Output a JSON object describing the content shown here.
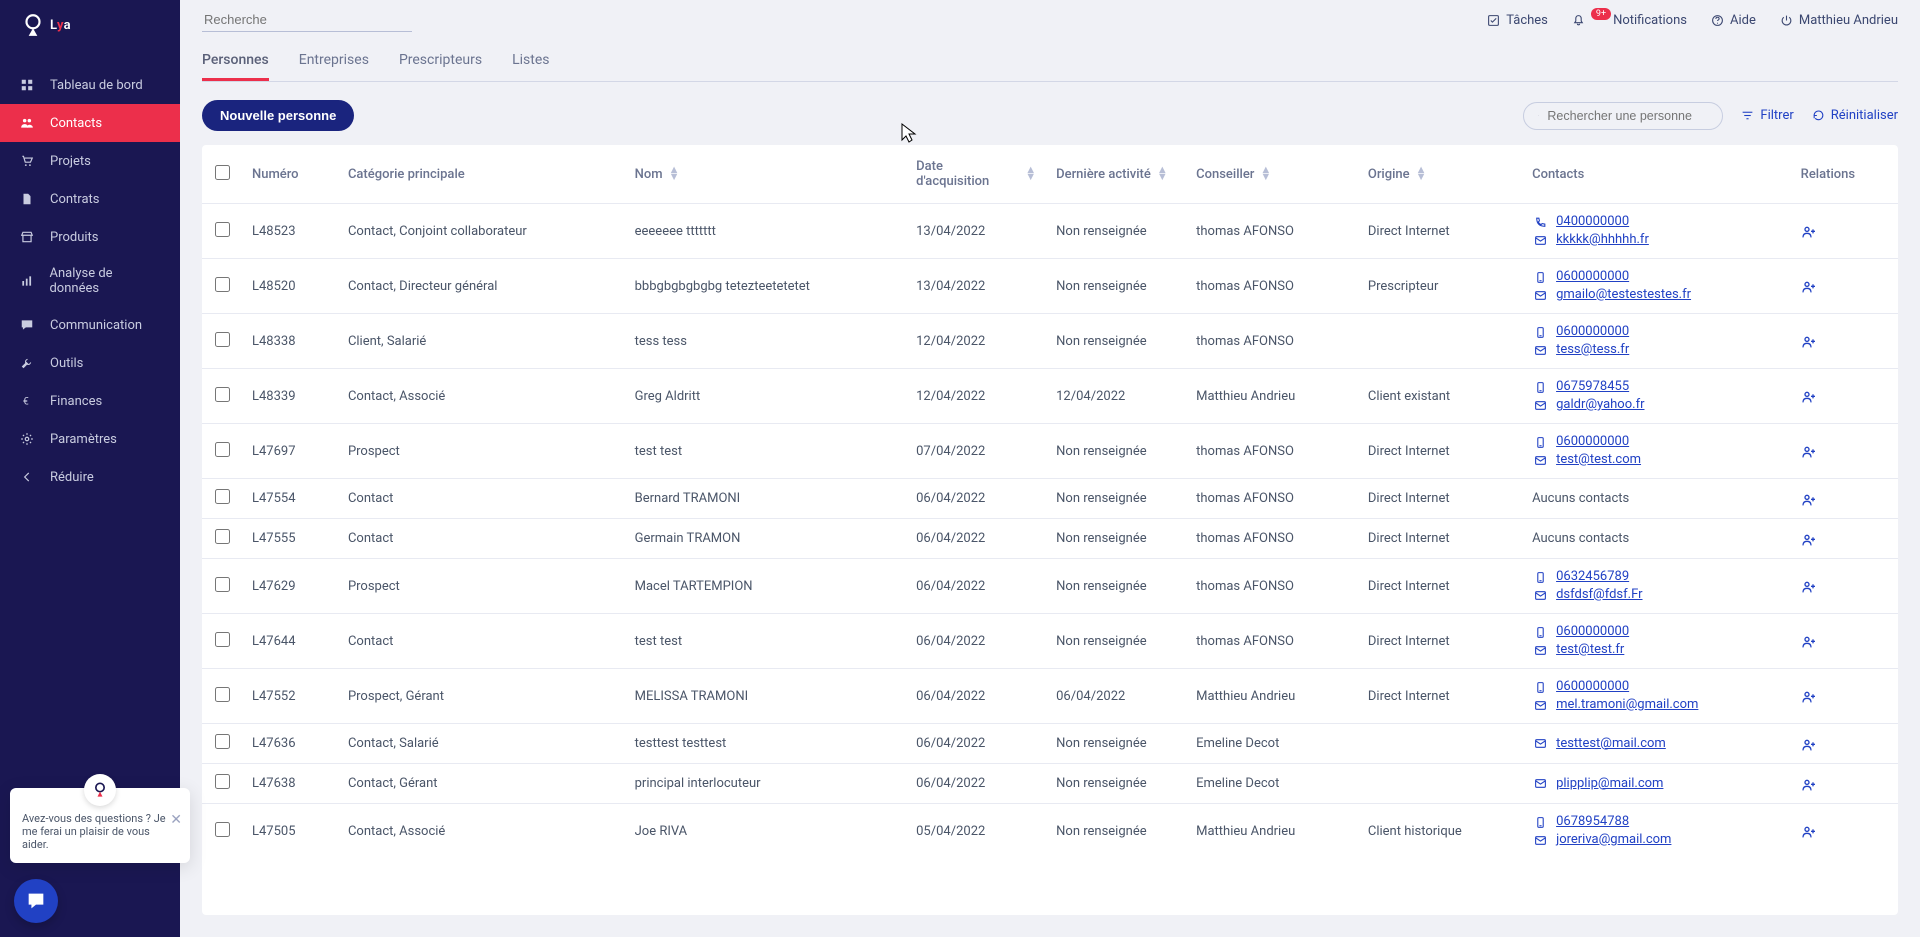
{
  "app_name": "Lya",
  "topbar": {
    "search_placeholder": "Recherche",
    "tasks_label": "Tâches",
    "notifications_label": "Notifications",
    "notifications_badge": "9+",
    "help_label": "Aide",
    "user_name": "Matthieu Andrieu"
  },
  "sidebar": {
    "items": [
      {
        "id": "dashboard",
        "label": "Tableau de bord",
        "icon": "grid"
      },
      {
        "id": "contacts",
        "label": "Contacts",
        "icon": "people",
        "active": true
      },
      {
        "id": "projects",
        "label": "Projets",
        "icon": "cart"
      },
      {
        "id": "contracts",
        "label": "Contrats",
        "icon": "file"
      },
      {
        "id": "products",
        "label": "Produits",
        "icon": "store"
      },
      {
        "id": "analytics",
        "label": "Analyse de données",
        "icon": "chart"
      },
      {
        "id": "communication",
        "label": "Communication",
        "icon": "chat"
      },
      {
        "id": "tools",
        "label": "Outils",
        "icon": "wrench"
      },
      {
        "id": "finances",
        "label": "Finances",
        "icon": "euro"
      },
      {
        "id": "settings",
        "label": "Paramètres",
        "icon": "gear"
      },
      {
        "id": "collapse",
        "label": "Réduire",
        "icon": "chevron-left"
      }
    ]
  },
  "tabs": [
    {
      "id": "personnes",
      "label": "Personnes",
      "active": true
    },
    {
      "id": "entreprises",
      "label": "Entreprises"
    },
    {
      "id": "prescripteurs",
      "label": "Prescripteurs"
    },
    {
      "id": "listes",
      "label": "Listes"
    }
  ],
  "toolbar": {
    "new_button": "Nouvelle personne",
    "search_placeholder": "Rechercher une personne",
    "filter_label": "Filtrer",
    "reset_label": "Réinitialiser"
  },
  "columns": {
    "numero": "Numéro",
    "categorie": "Catégorie principale",
    "nom": "Nom",
    "acquisition": "Date d'acquisition",
    "activite": "Dernière activité",
    "conseiller": "Conseiller",
    "origine": "Origine",
    "contacts": "Contacts",
    "relations": "Relations"
  },
  "rows": [
    {
      "numero": "L48523",
      "categorie": "Contact, Conjoint collaborateur",
      "nom": "eeeeeee ttttttt",
      "acquisition": "13/04/2022",
      "activite": "Non renseignée",
      "conseiller": "thomas AFONSO",
      "origine": "Direct Internet",
      "phone": "0400000000",
      "email": "kkkkk@hhhhh.fr"
    },
    {
      "numero": "L48520",
      "categorie": "Contact, Directeur général",
      "nom": "bbbgbgbgbgbg tetezteetetetet",
      "acquisition": "13/04/2022",
      "activite": "Non renseignée",
      "conseiller": "thomas AFONSO",
      "origine": "Prescripteur",
      "phone": "0600000000",
      "email": "gmailo@testestestes.fr"
    },
    {
      "numero": "L48338",
      "categorie": "Client, Salarié",
      "nom": "tess tess",
      "acquisition": "12/04/2022",
      "activite": "Non renseignée",
      "conseiller": "thomas AFONSO",
      "origine": "",
      "phone": "0600000000",
      "email": "tess@tess.fr"
    },
    {
      "numero": "L48339",
      "categorie": "Contact, Associé",
      "nom": "Greg Aldritt",
      "acquisition": "12/04/2022",
      "activite": "12/04/2022",
      "conseiller": "Matthieu Andrieu",
      "origine": "Client existant",
      "phone": "0675978455",
      "email": "galdr@yahoo.fr"
    },
    {
      "numero": "L47697",
      "categorie": "Prospect",
      "nom": "test test",
      "acquisition": "07/04/2022",
      "activite": "Non renseignée",
      "conseiller": "thomas AFONSO",
      "origine": "Direct Internet",
      "phone": "0600000000",
      "email": "test@test.com"
    },
    {
      "numero": "L47554",
      "categorie": "Contact",
      "nom": "Bernard TRAMONI",
      "acquisition": "06/04/2022",
      "activite": "Non renseignée",
      "conseiller": "thomas AFONSO",
      "origine": "Direct Internet",
      "no_contact": "Aucuns contacts"
    },
    {
      "numero": "L47555",
      "categorie": "Contact",
      "nom": "Germain TRAMON",
      "acquisition": "06/04/2022",
      "activite": "Non renseignée",
      "conseiller": "thomas AFONSO",
      "origine": "Direct Internet",
      "no_contact": "Aucuns contacts"
    },
    {
      "numero": "L47629",
      "categorie": "Prospect",
      "nom": "Macel TARTEMPION",
      "acquisition": "06/04/2022",
      "activite": "Non renseignée",
      "conseiller": "thomas AFONSO",
      "origine": "Direct Internet",
      "phone": "0632456789",
      "email": "dsfdsf@fdsf.Fr"
    },
    {
      "numero": "L47644",
      "categorie": "Contact",
      "nom": "test test",
      "acquisition": "06/04/2022",
      "activite": "Non renseignée",
      "conseiller": "thomas AFONSO",
      "origine": "Direct Internet",
      "phone": "0600000000",
      "email": "test@test.fr"
    },
    {
      "numero": "L47552",
      "categorie": "Prospect, Gérant",
      "nom": "MELISSA TRAMONI",
      "acquisition": "06/04/2022",
      "activite": "06/04/2022",
      "conseiller": "Matthieu Andrieu",
      "origine": "Direct Internet",
      "phone": "0600000000",
      "email": "mel.tramoni@gmail.com"
    },
    {
      "numero": "L47636",
      "categorie": "Contact, Salarié",
      "nom": "testtest testtest",
      "acquisition": "06/04/2022",
      "activite": "Non renseignée",
      "conseiller": "Emeline Decot",
      "origine": "",
      "email": "testtest@mail.com"
    },
    {
      "numero": "L47638",
      "categorie": "Contact, Gérant",
      "nom": "principal interlocuteur",
      "acquisition": "06/04/2022",
      "activite": "Non renseignée",
      "conseiller": "Emeline Decot",
      "origine": "",
      "email": "plipplip@mail.com"
    },
    {
      "numero": "L47505",
      "categorie": "Contact, Associé",
      "nom": "Joe RIVA",
      "acquisition": "05/04/2022",
      "activite": "Non renseignée",
      "conseiller": "Matthieu Andrieu",
      "origine": "Client historique",
      "phone": "0678954788",
      "email": "joreriva@gmail.com"
    }
  ],
  "help": {
    "text": "Avez-vous des questions ? Je me ferai un plaisir de vous aider."
  }
}
